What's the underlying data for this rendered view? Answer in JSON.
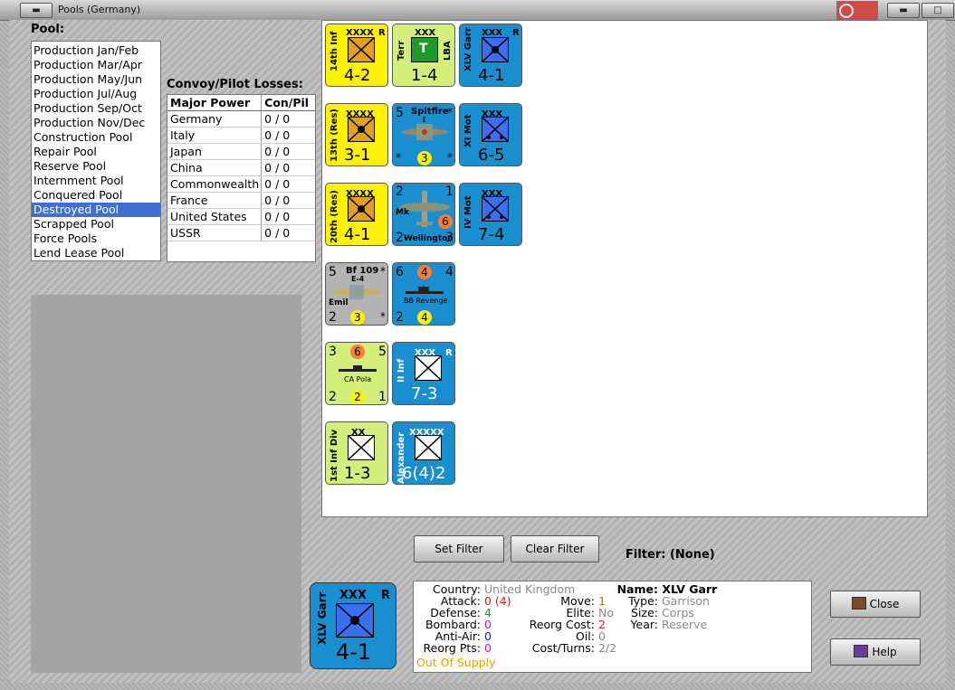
{
  "window": {
    "title": "Pools (Germany)"
  },
  "pool": {
    "label": "Pool:",
    "items": [
      "Production Jan/Feb",
      "Production Mar/Apr",
      "Production May/Jun",
      "Production Jul/Aug",
      "Production Sep/Oct",
      "Production Nov/Dec",
      "Construction Pool",
      "Repair Pool",
      "Reserve Pool",
      "Internment Pool",
      "Conquered Pool",
      "Destroyed Pool",
      "Scrapped Pool",
      "Force Pools",
      "Lend Lease Pool"
    ],
    "selected": "Destroyed Pool"
  },
  "losses": {
    "label": "Convoy/Pilot Losses:",
    "headers": [
      "Major Power",
      "Con/Pil"
    ],
    "rows": [
      [
        "Germany",
        "0 / 0"
      ],
      [
        "Italy",
        "0 / 0"
      ],
      [
        "Japan",
        "0 / 0"
      ],
      [
        "China",
        "0 / 0"
      ],
      [
        "Commonwealth",
        "0 / 0"
      ],
      [
        "France",
        "0 / 0"
      ],
      [
        "United States",
        "0 / 0"
      ],
      [
        "USSR",
        "0 / 0"
      ]
    ]
  },
  "counters": {
    "c1": {
      "name": "14th Inf",
      "size": "XXXX",
      "tag": "R",
      "value": "4-2"
    },
    "c2": {
      "name": "Terr",
      "size": "XXX",
      "sym": "T",
      "tag": "LBA",
      "value": "1-4"
    },
    "c3": {
      "name": "XLV Garr",
      "size": "XXX",
      "tag": "R",
      "value": "4-1"
    },
    "c4": {
      "name": "13th (Res)",
      "size": "XXXX",
      "value": "3-1"
    },
    "c5": {
      "name": "Spitfire",
      "sub": "I",
      "tl": "5",
      "tr": "*",
      "bl": "*",
      "br": "*",
      "badge": "3"
    },
    "c6": {
      "name": "XI Mot",
      "size": "XXX",
      "value": "6-5"
    },
    "c7": {
      "name": "20th (Res)",
      "size": "XXXX",
      "value": "4-1"
    },
    "c8": {
      "name": "Wellington",
      "mk": "Mk",
      "tl": "2",
      "tr": "1",
      "bl": "2",
      "br": "3",
      "badge": "6"
    },
    "c9": {
      "name": "IV Mot",
      "size": "XXX",
      "value": "7-4"
    },
    "c10": {
      "name": "Bf 109",
      "sub": "E-4",
      "nick": "Emil",
      "tl": "5",
      "tr": "*",
      "bl": "2",
      "br": "*",
      "badge": "3"
    },
    "c11": {
      "name": "BB Revenge",
      "tl": "6",
      "tr": "4",
      "bl": "2",
      "badge_top": "4",
      "badge": "4"
    },
    "c12": {
      "name": "CA Pola",
      "tl": "3",
      "tr": "5",
      "bl": "2",
      "br": "1",
      "badge_top": "6",
      "badge": "2"
    },
    "c13": {
      "name": "II Inf",
      "size": "XXX",
      "tag": "R",
      "value": "7-3"
    },
    "c14": {
      "name": "1st Inf Div",
      "size": "XX",
      "value": "1-3"
    },
    "c15": {
      "name": "Alexander",
      "size": "XXXXX",
      "value": "6(4)2"
    }
  },
  "filter": {
    "set_label": "Set Filter",
    "clear_label": "Clear Filter",
    "label": "Filter:",
    "value": "(None)"
  },
  "info": {
    "country_label": "Country:",
    "country": "United Kingdom",
    "attack_label": "Attack:",
    "attack": "0",
    "attack_paren": "(4)",
    "defense_label": "Defense:",
    "defense": "4",
    "bombard_label": "Bombard:",
    "bombard": "0",
    "antiair_label": "Anti-Air:",
    "antiair": "0",
    "reorgpts_label": "Reorg Pts:",
    "reorgpts": "0",
    "supply": "Out Of Supply",
    "move_label": "Move:",
    "move": "1",
    "elite_label": "Elite:",
    "elite": "No",
    "reorgcost_label": "Reorg Cost:",
    "reorgcost": "2",
    "oil_label": "Oil:",
    "oil": "0",
    "costturns_label": "Cost/Turns:",
    "costturns": "2/2",
    "name_label": "Name:",
    "name": "XLV Garr",
    "type_label": "Type:",
    "type": "Garrison",
    "size_label": "Size:",
    "size": "Corps",
    "year_label": "Year:",
    "year": "Reserve"
  },
  "selected_counter": {
    "name": "XLV Garr",
    "size": "XXX",
    "tag": "R",
    "value": "4-1"
  },
  "buttons": {
    "close": "Close",
    "help": "Help"
  }
}
